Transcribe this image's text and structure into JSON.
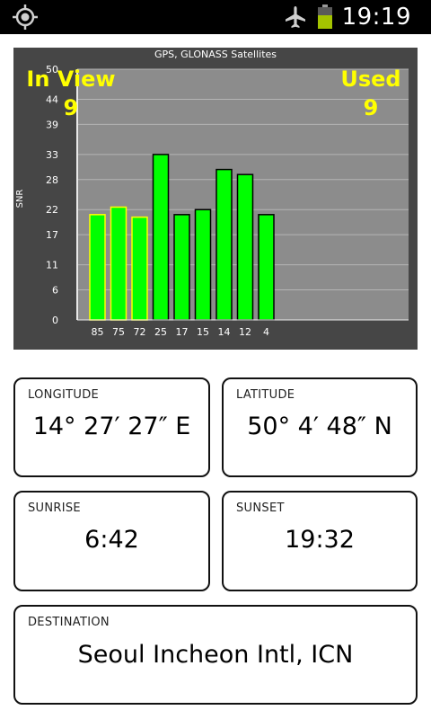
{
  "status_bar": {
    "time": "19:19",
    "icons": [
      "gps-target-icon",
      "airplane-mode-icon",
      "battery-icon"
    ],
    "battery_color": "#a4c400"
  },
  "chart_data": {
    "type": "bar",
    "title": "GPS, GLONASS Satellites",
    "ylabel": "SNR",
    "ylim": [
      0,
      50
    ],
    "yticks": [
      0,
      6,
      11,
      17,
      22,
      28,
      33,
      39,
      44,
      50
    ],
    "categories": [
      "85",
      "75",
      "72",
      "25",
      "17",
      "15",
      "14",
      "12",
      "4"
    ],
    "values": [
      21,
      22.5,
      20.5,
      33,
      21,
      22,
      30,
      29,
      21
    ],
    "bar_border_colors": [
      "#ffff00",
      "#ffff00",
      "#ffff00",
      "#000000",
      "#000000",
      "#000000",
      "#000000",
      "#000000",
      "#000000"
    ],
    "bar_fill_color": "#00ff00",
    "in_view_label": "In View",
    "in_view_count": "9",
    "used_label": "Used",
    "used_count": "9",
    "overlay_text_color": "#ffff00",
    "plot_background": "#8c8c8c",
    "panel_background": "#464646"
  },
  "cards": {
    "longitude": {
      "label": "LONGITUDE",
      "value": "14° 27′ 27″ E"
    },
    "latitude": {
      "label": "LATITUDE",
      "value": "50° 4′ 48″ N"
    },
    "sunrise": {
      "label": "SUNRISE",
      "value": "6:42"
    },
    "sunset": {
      "label": "SUNSET",
      "value": "19:32"
    },
    "destination": {
      "label": "DESTINATION",
      "value": "Seoul Incheon Intl, ICN"
    }
  }
}
